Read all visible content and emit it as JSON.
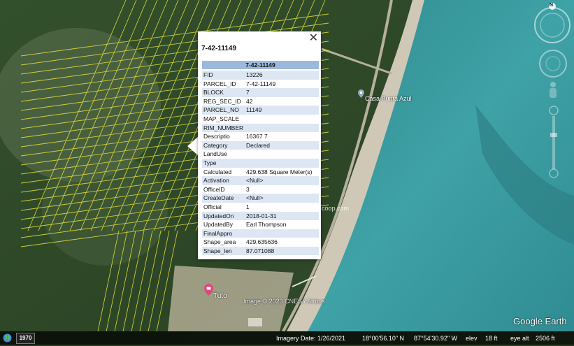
{
  "popup": {
    "close_label": "✕",
    "title": "7-42-11149",
    "table_header": "7-42-11149",
    "attributes": [
      {
        "key": "FID",
        "value": "13226"
      },
      {
        "key": "PARCEL_ID",
        "value": "7-42-11149"
      },
      {
        "key": "BLOCK",
        "value": "7"
      },
      {
        "key": "REG_SEC_ID",
        "value": "42"
      },
      {
        "key": "PARCEL_NO",
        "value": "11149"
      },
      {
        "key": "MAP_SCALE",
        "value": ""
      },
      {
        "key": "RIM_NUMBER",
        "value": ""
      },
      {
        "key": "Descriptio",
        "value": "16367 7"
      },
      {
        "key": "Category",
        "value": "Declared"
      },
      {
        "key": "LandUse",
        "value": ""
      },
      {
        "key": "Type",
        "value": ""
      },
      {
        "key": "Calculated",
        "value": "429.638 Square Meter(s)"
      },
      {
        "key": "Activation",
        "value": "<Null>"
      },
      {
        "key": "OfficeID",
        "value": "3"
      },
      {
        "key": "CreateDate",
        "value": "<Null>"
      },
      {
        "key": "Official",
        "value": "1"
      },
      {
        "key": "UpdatedOn",
        "value": "2018-01-31"
      },
      {
        "key": "UpdatedBy",
        "value": "Earl Thompson"
      },
      {
        "key": "FinalAppro",
        "value": ""
      },
      {
        "key": "Shape_area",
        "value": "429.635636"
      },
      {
        "key": "Shape_len",
        "value": "87.071088"
      }
    ]
  },
  "places": {
    "casa_punta_azul": "Casa Punta Azul",
    "tuto": "Tuto",
    "watermark_fragment": "coop.com"
  },
  "compass": {
    "north_label": "N"
  },
  "copyright": "Image © 2023 CNES / Airbus",
  "brand": "Google Earth",
  "status": {
    "year": "1970",
    "imagery_date": "Imagery Date: 1/26/2021",
    "latitude": "18°00'56.10\" N",
    "longitude": "87°54'30.92\" W",
    "elev_label": "elev",
    "elev_value": "18 ft",
    "eye_alt_label": "eye alt",
    "eye_alt_value": "2506 ft"
  },
  "colors": {
    "parcel_lines": "#e8e23a",
    "forest": "#2f4a2a",
    "sea": "#3f9a9c",
    "beach": "#c9c2b0",
    "popup_header": "#9cb9dd",
    "row_alt": "#dde7f3"
  }
}
